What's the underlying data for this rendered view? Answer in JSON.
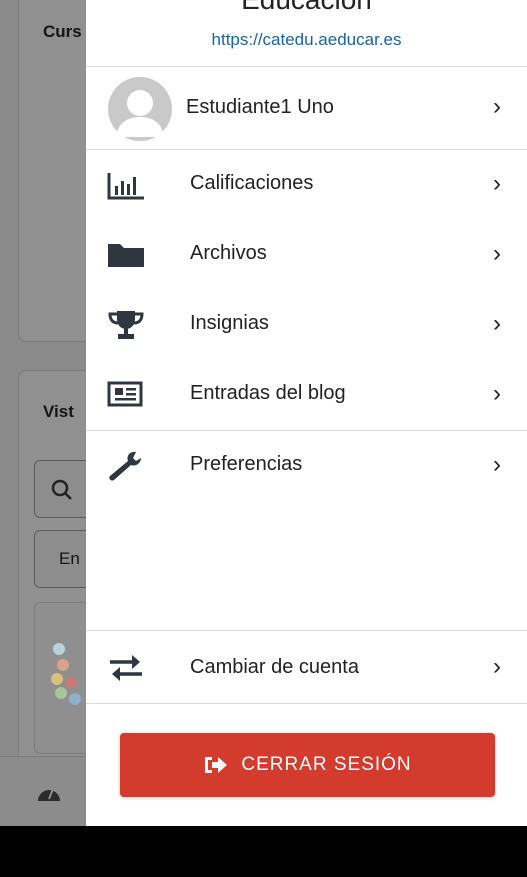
{
  "background": {
    "card_title_1": "Curs",
    "card_title_2": "Vist",
    "select_value": "En"
  },
  "drawer": {
    "site_name": "Educación",
    "site_url": "https://catedu.aeducar.es",
    "user_name": "Estudiante1 Uno",
    "items": [
      {
        "label": "Calificaciones",
        "icon": "chart-bar-icon"
      },
      {
        "label": "Archivos",
        "icon": "folder-icon"
      },
      {
        "label": "Insignias",
        "icon": "trophy-icon"
      },
      {
        "label": "Entradas del blog",
        "icon": "newspaper-icon"
      },
      {
        "label": "Preferencias",
        "icon": "wrench-icon"
      }
    ],
    "switch_account": "Cambiar de cuenta",
    "logout": "CERRAR SESIÓN",
    "chevron": "›"
  },
  "colors": {
    "accent_link": "#1565a8",
    "logout_button": "#d33b2c",
    "icon": "#2f3640"
  }
}
